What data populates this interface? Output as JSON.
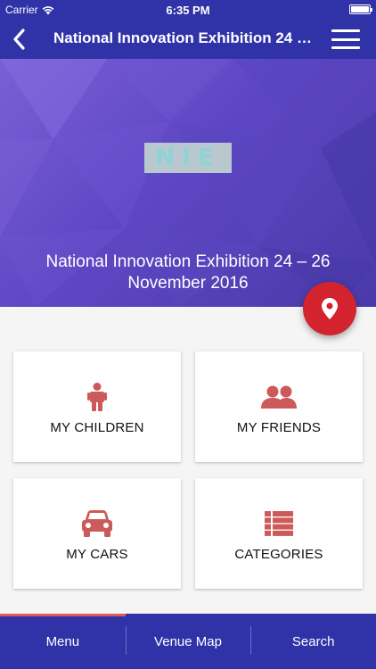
{
  "status_bar": {
    "carrier": "Carrier",
    "time": "6:35 PM"
  },
  "nav": {
    "title": "National Innovation Exhibition 24 –..."
  },
  "hero": {
    "logo_text": "NIE",
    "title": "National Innovation Exhibition 24 – 26 November 2016"
  },
  "tiles": [
    {
      "label": "MY CHILDREN",
      "icon": "child-icon"
    },
    {
      "label": "MY FRIENDS",
      "icon": "friends-icon"
    },
    {
      "label": "MY CARS",
      "icon": "car-icon"
    },
    {
      "label": "CATEGORIES",
      "icon": "categories-icon"
    }
  ],
  "tabbar": {
    "items": [
      {
        "label": "Menu",
        "active": true
      },
      {
        "label": "Venue Map",
        "active": false
      },
      {
        "label": "Search",
        "active": false
      }
    ]
  },
  "colors": {
    "primary": "#3033a8",
    "accent": "#d3232f",
    "tile_icon": "#cd5a5a"
  }
}
